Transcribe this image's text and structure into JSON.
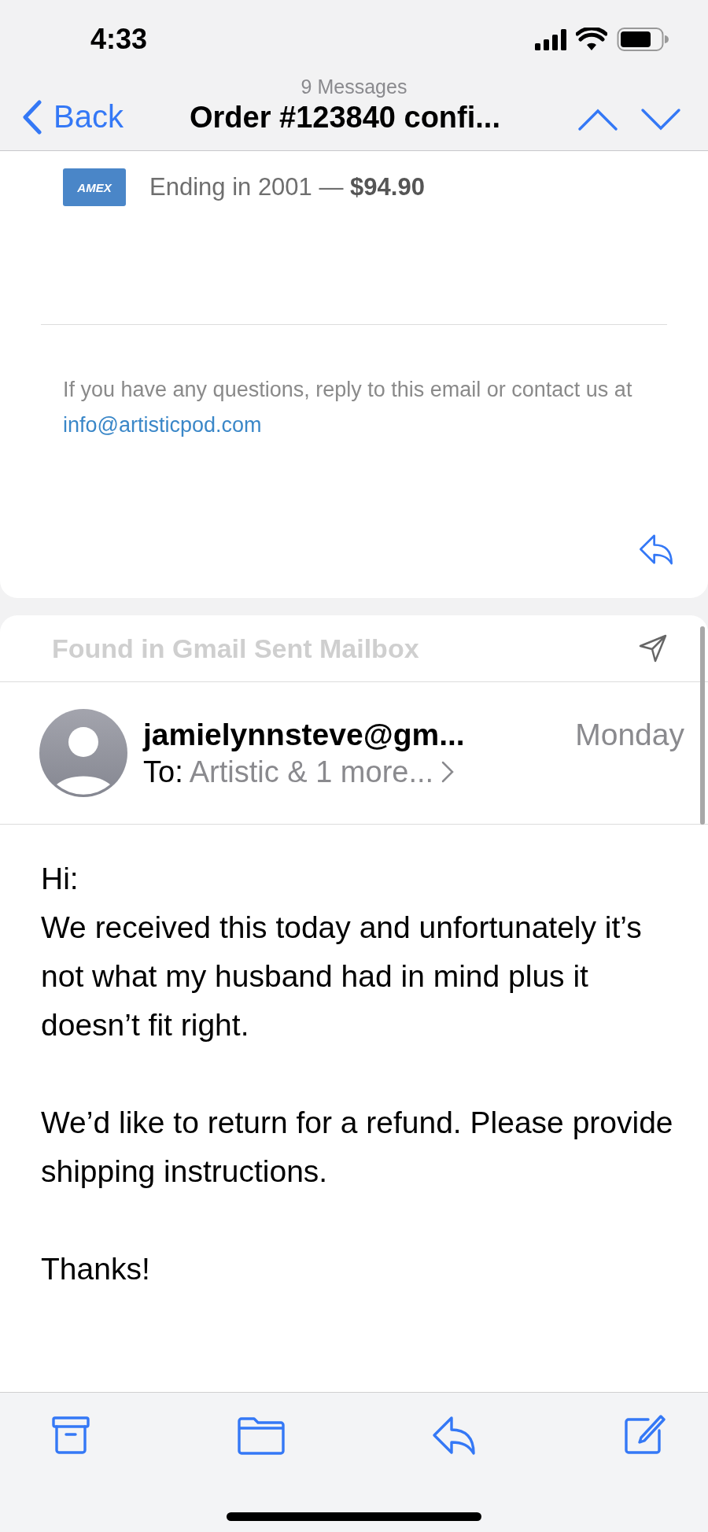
{
  "status_bar": {
    "time": "4:33"
  },
  "nav": {
    "back": "Back",
    "subtitle": "9 Messages",
    "title": "Order #123840 confi..."
  },
  "previous_message": {
    "payment": {
      "card": "AMEX",
      "text": "Ending in 2001 — ",
      "amount": "$94.90"
    },
    "footer": "If you have any questions, reply to this email or contact us at ",
    "footer_link": "info@artisticpod.com"
  },
  "message": {
    "found_in": "Found in Gmail Sent Mailbox",
    "sender": "jamielynnsteve@gm...",
    "date": "Monday",
    "to_label": "To:",
    "recipients": "Artistic & 1 more...",
    "paragraphs": [
      {
        "lines": [
          "Hi:",
          "We received this today and unfortunately it’s not what my husband had in mind plus it doesn’t fit right."
        ]
      },
      {
        "lines": [
          "We’d like to return for a refund.  Please provide shipping instructions."
        ]
      },
      {
        "lines": [
          "Thanks!"
        ]
      }
    ]
  },
  "toolbar": [
    {
      "kind": "archive"
    },
    {
      "kind": "folder"
    },
    {
      "kind": "reply"
    },
    {
      "kind": "compose"
    }
  ]
}
